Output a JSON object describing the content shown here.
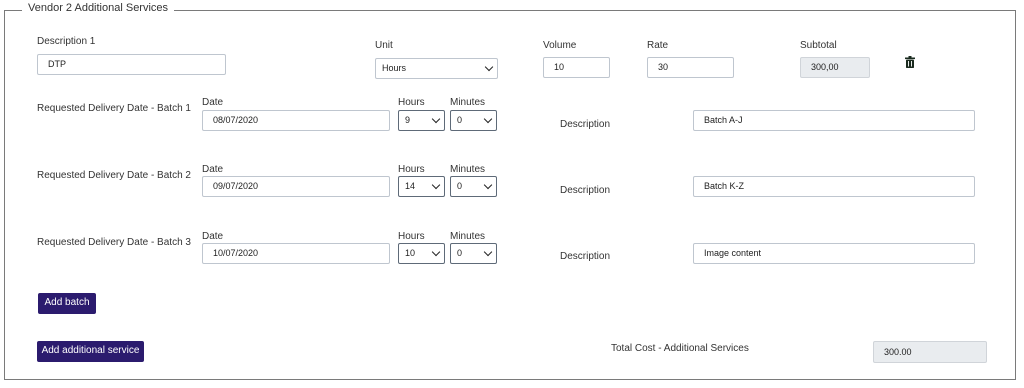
{
  "section": {
    "legend": "Vendor 2 Additional Services"
  },
  "service": {
    "description_label": "Description 1",
    "description_value": "DTP",
    "unit_label": "Unit",
    "unit_value": "Hours",
    "volume_label": "Volume",
    "volume_value": "10",
    "rate_label": "Rate",
    "rate_value": "30",
    "subtotal_label": "Subtotal",
    "subtotal_value": "300,00",
    "delete_icon": "trash-icon"
  },
  "batches": [
    {
      "label": "Requested Delivery Date - Batch 1",
      "date_label": "Date",
      "date": "08/07/2020",
      "hours_label": "Hours",
      "hours": "9",
      "minutes_label": "Minutes",
      "minutes": "0",
      "description_label": "Description",
      "description": "Batch A-J"
    },
    {
      "label": "Requested Delivery Date - Batch 2",
      "date_label": "Date",
      "date": "09/07/2020",
      "hours_label": "Hours",
      "hours": "14",
      "minutes_label": "Minutes",
      "minutes": "0",
      "description_label": "Description",
      "description": "Batch K-Z"
    },
    {
      "label": "Requested Delivery Date - Batch 3",
      "date_label": "Date",
      "date": "10/07/2020",
      "hours_label": "Hours",
      "hours": "10",
      "minutes_label": "Minutes",
      "minutes": "0",
      "description_label": "Description",
      "description": "Image content"
    }
  ],
  "buttons": {
    "add_batch": "Add batch",
    "add_service": "Add additional service"
  },
  "total": {
    "label": "Total Cost - Additional Services",
    "value": "300.00"
  },
  "colors": {
    "button": "#2b1b6e",
    "readonly": "#e9ecef"
  }
}
